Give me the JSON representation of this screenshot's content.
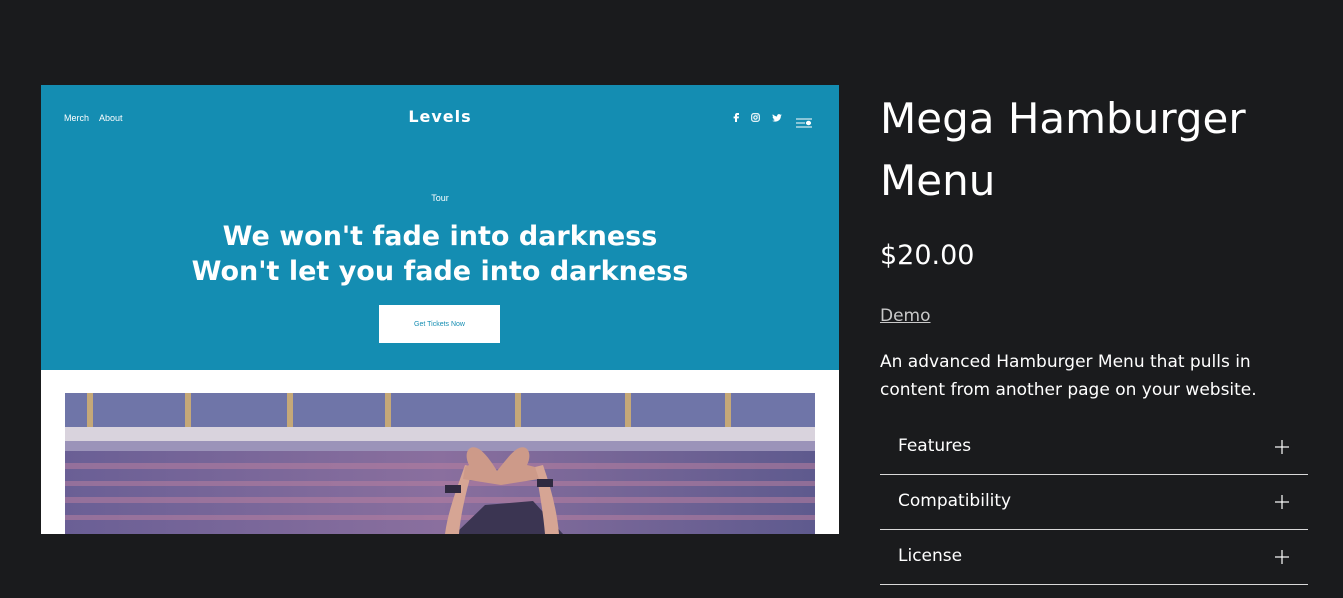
{
  "preview": {
    "nav": {
      "merch": "Merch",
      "about": "About"
    },
    "logo": "Levels",
    "social_icons": [
      "facebook-icon",
      "instagram-icon",
      "twitter-icon"
    ],
    "menu_icon": "hamburger-menu-icon",
    "eyebrow": "Tour",
    "headline_line1": "We won't fade into darkness",
    "headline_line2": "Won't let you fade into darkness",
    "cta_label": "Get Tickets Now",
    "hero_color": "#148db2"
  },
  "product": {
    "title": "Mega Hamburger Menu",
    "price": "$20.00",
    "demo_link": "Demo",
    "description": "An advanced Hamburger Menu that pulls in content from another page on your website."
  },
  "accordion": {
    "items": [
      {
        "label": "Features",
        "icon": "plus-icon"
      },
      {
        "label": "Compatibility",
        "icon": "plus-icon"
      },
      {
        "label": "License",
        "icon": "plus-icon"
      }
    ]
  }
}
